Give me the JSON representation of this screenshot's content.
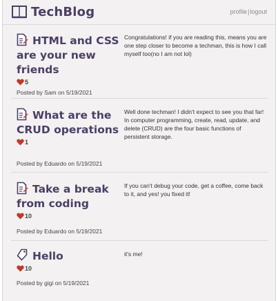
{
  "header": {
    "title": "TechBlog",
    "profile_link": "profile",
    "separator": "|",
    "logout_link": "logout"
  },
  "colors": {
    "title": "#4b3f63",
    "heart": "#c0392b",
    "background": "#f3f1f2"
  },
  "posts": [
    {
      "icon": "document-pen-icon",
      "title": "HTML and CSS are your new friends",
      "likes": "5",
      "meta": "Posted by Sam on 5/19/2021",
      "body": "Congratulations! if you are reading this, means you are one step closer to become a techman, this is how I call myself too(no I am not lol)"
    },
    {
      "icon": "document-pen-icon",
      "title": "What are the CRUD operations",
      "likes": "1",
      "meta": "Posted by Eduardo on 5/19/2021",
      "body": "Well done techman! I didn't expect to see you that far! In computer programming, create, read, update, and delete (CRUD) are the four basic functions of persistent storage."
    },
    {
      "icon": "document-pen-icon",
      "title": "Take a break from coding",
      "likes": "10",
      "meta": "Posted by Eduardo on 5/19/2021",
      "body": "If you can't debug your code, get a coffee, come back to it, and yes! you fixed it!"
    },
    {
      "icon": "tag-icon",
      "title": "Hello",
      "likes": "10",
      "meta": "Posted by gigi on 5/19/2021",
      "body": "it's me!"
    }
  ]
}
